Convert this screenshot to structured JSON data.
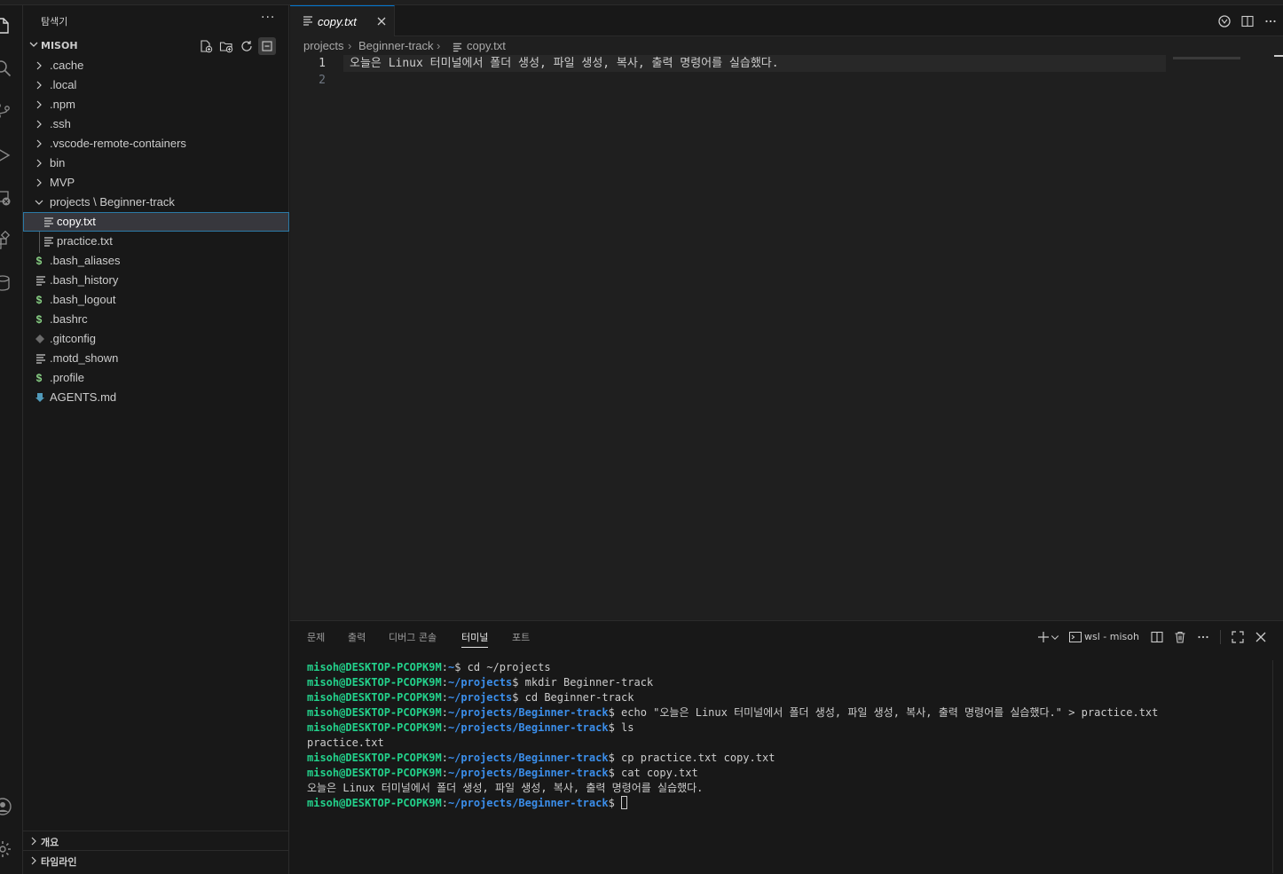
{
  "sidebar": {
    "title": "탐색기",
    "more": "···",
    "root": "MISOH",
    "items": [
      {
        "label": ".cache",
        "kind": "folder",
        "expanded": false
      },
      {
        "label": ".local",
        "kind": "folder",
        "expanded": false
      },
      {
        "label": ".npm",
        "kind": "folder",
        "expanded": false
      },
      {
        "label": ".ssh",
        "kind": "folder",
        "expanded": false
      },
      {
        "label": ".vscode-remote-containers",
        "kind": "folder",
        "expanded": false
      },
      {
        "label": "bin",
        "kind": "folder",
        "expanded": false
      },
      {
        "label": "MVP",
        "kind": "folder",
        "expanded": false
      },
      {
        "label": "projects \\ Beginner-track",
        "kind": "folder",
        "expanded": true
      },
      {
        "label": "copy.txt",
        "kind": "file-text",
        "selected": true
      },
      {
        "label": "practice.txt",
        "kind": "file-text"
      },
      {
        "label": ".bash_aliases",
        "kind": "file-shell",
        "icon": "$"
      },
      {
        "label": ".bash_history",
        "kind": "file-text"
      },
      {
        "label": ".bash_logout",
        "kind": "file-shell",
        "icon": "$"
      },
      {
        "label": ".bashrc",
        "kind": "file-shell",
        "icon": "$"
      },
      {
        "label": ".gitconfig",
        "kind": "file-git"
      },
      {
        "label": ".motd_shown",
        "kind": "file-text"
      },
      {
        "label": ".profile",
        "kind": "file-shell",
        "icon": "$"
      },
      {
        "label": "AGENTS.md",
        "kind": "file-md"
      }
    ],
    "bottom_sections": [
      "개요",
      "타임라인"
    ]
  },
  "editor": {
    "tab_label": "copy.txt",
    "breadcrumb": [
      "projects",
      "Beginner-track",
      "copy.txt"
    ],
    "lines": [
      {
        "number": "1",
        "text": "오늘은 Linux 터미널에서 폴더 생성, 파일 생성, 복사, 출력 명령어를 실습했다."
      },
      {
        "number": "2",
        "text": ""
      }
    ]
  },
  "panel": {
    "tabs": [
      "문제",
      "출력",
      "디버그 콘솔",
      "터미널",
      "포트"
    ],
    "active_tab": "터미널",
    "shell_label": "wsl - misoh",
    "terminal": [
      {
        "user": "misoh@DESKTOP-PCOPK9M",
        "path": "~",
        "cmd": " cd ~/projects"
      },
      {
        "user": "misoh@DESKTOP-PCOPK9M",
        "path": "~/projects",
        "cmd": " mkdir Beginner-track"
      },
      {
        "user": "misoh@DESKTOP-PCOPK9M",
        "path": "~/projects",
        "cmd": " cd Beginner-track"
      },
      {
        "user": "misoh@DESKTOP-PCOPK9M",
        "path": "~/projects/Beginner-track",
        "cmd": " echo \"오늘은 Linux 터미널에서 폴더 생성, 파일 생성, 복사, 출력 명령어를 실습했다.\" > practice.txt"
      },
      {
        "user": "misoh@DESKTOP-PCOPK9M",
        "path": "~/projects/Beginner-track",
        "cmd": " ls"
      },
      {
        "output": "practice.txt"
      },
      {
        "user": "misoh@DESKTOP-PCOPK9M",
        "path": "~/projects/Beginner-track",
        "cmd": " cp practice.txt copy.txt"
      },
      {
        "user": "misoh@DESKTOP-PCOPK9M",
        "path": "~/projects/Beginner-track",
        "cmd": " cat copy.txt"
      },
      {
        "output": "오늘은 Linux 터미널에서 폴더 생성, 파일 생성, 복사, 출력 명령어를 실습했다."
      },
      {
        "user": "misoh@DESKTOP-PCOPK9M",
        "path": "~/projects/Beginner-track",
        "cmd": " ",
        "cursor": true
      }
    ]
  },
  "colors": {
    "accent": "#0078d4",
    "shell_icon": "#89d185",
    "md_icon": "#519aba",
    "term_user": "#23d18b",
    "term_path": "#3b8eea"
  },
  "icons": {
    "activity": [
      "files-icon",
      "search-icon",
      "source-control-icon",
      "run-debug-icon",
      "remote-explorer-icon",
      "extensions-icon",
      "database-icon",
      "account-icon",
      "settings-gear-icon"
    ]
  }
}
